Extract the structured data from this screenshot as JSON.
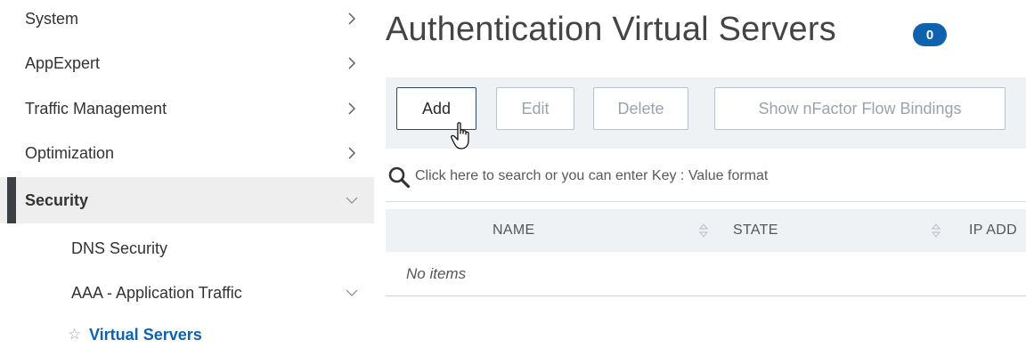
{
  "sidebar": {
    "items": [
      {
        "label": "System"
      },
      {
        "label": "AppExpert"
      },
      {
        "label": "Traffic Management"
      },
      {
        "label": "Optimization"
      },
      {
        "label": "Security"
      },
      {
        "label": "DNS Security"
      },
      {
        "label": "AAA - Application Traffic"
      },
      {
        "label": "Virtual Servers"
      }
    ]
  },
  "main": {
    "title": "Authentication Virtual Servers",
    "count": "0",
    "toolbar": {
      "add": "Add",
      "edit": "Edit",
      "delete": "Delete",
      "show_bindings": "Show nFactor Flow Bindings"
    },
    "search": {
      "placeholder": "Click here to search or you can enter Key : Value format"
    },
    "table": {
      "columns": [
        "NAME",
        "STATE",
        "IP ADD"
      ],
      "empty": "No items"
    }
  },
  "colors": {
    "accent": "#0f62ae",
    "selected_bar": "#3c3f44",
    "toolbar_bg": "#eff2f5"
  },
  "icons": [
    "chevron-right-icon",
    "chevron-down-icon",
    "star-icon",
    "search-icon",
    "sort-icon",
    "hand-cursor-icon"
  ]
}
